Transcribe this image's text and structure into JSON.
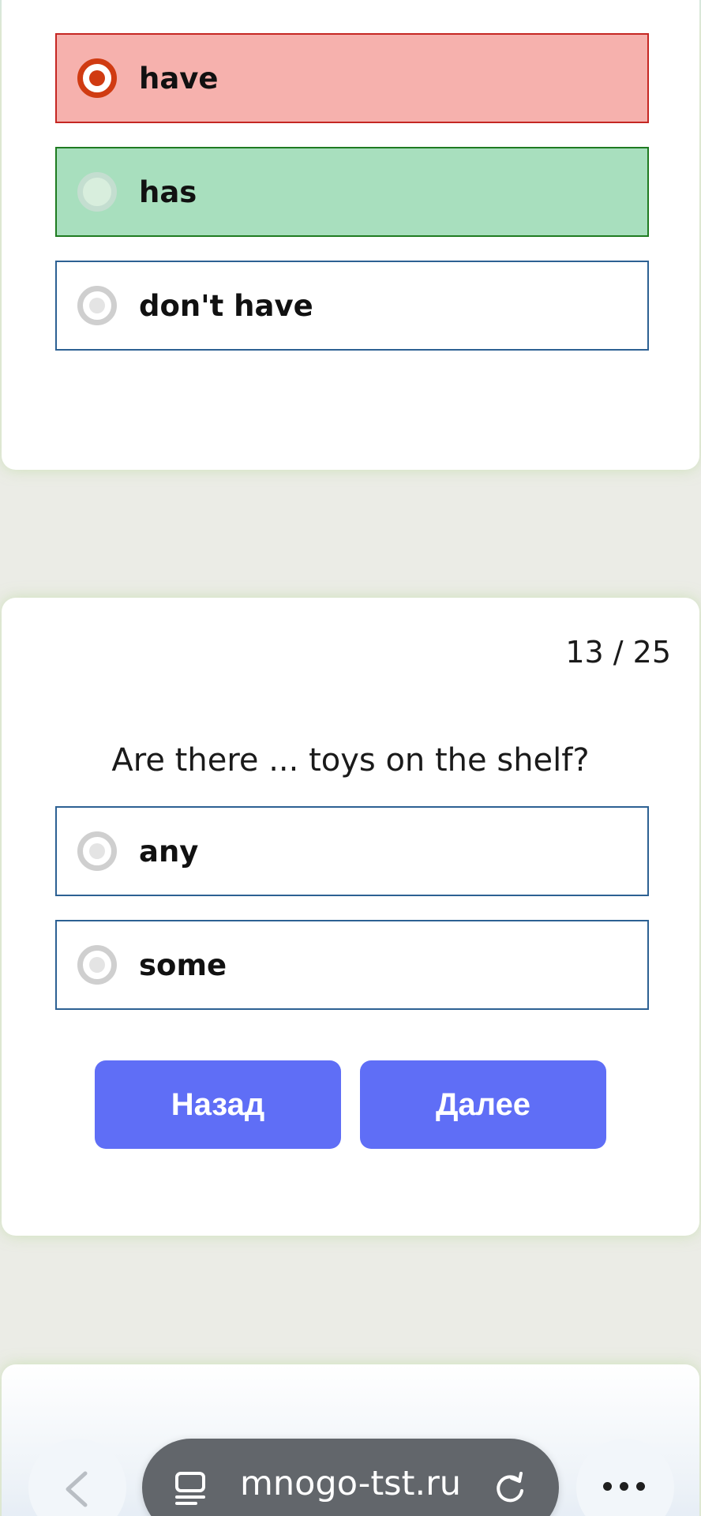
{
  "previous_question": {
    "options": [
      {
        "label": "have",
        "state": "wrong-selected"
      },
      {
        "label": "has",
        "state": "correct"
      },
      {
        "label": "don't have",
        "state": "unselected"
      }
    ]
  },
  "current_question": {
    "counter": "13 / 25",
    "text": "Are there ... toys on the shelf?",
    "options": [
      {
        "label": "any",
        "state": "unselected"
      },
      {
        "label": "some",
        "state": "unselected"
      }
    ],
    "back_label": "Назад",
    "next_label": "Далее"
  },
  "browser": {
    "url": "mnogo-tst.ru",
    "icons": [
      "chevron-left-icon",
      "reader-icon",
      "reload-icon",
      "more-icon"
    ]
  },
  "colors": {
    "wrong_bg": "#f6b1ad",
    "wrong_border": "#c52723",
    "correct_bg": "#a8dfbe",
    "correct_border": "#1f7b21",
    "option_border": "#2d6193",
    "button": "#5f6ef6",
    "selected_radio": "#d03b12"
  }
}
